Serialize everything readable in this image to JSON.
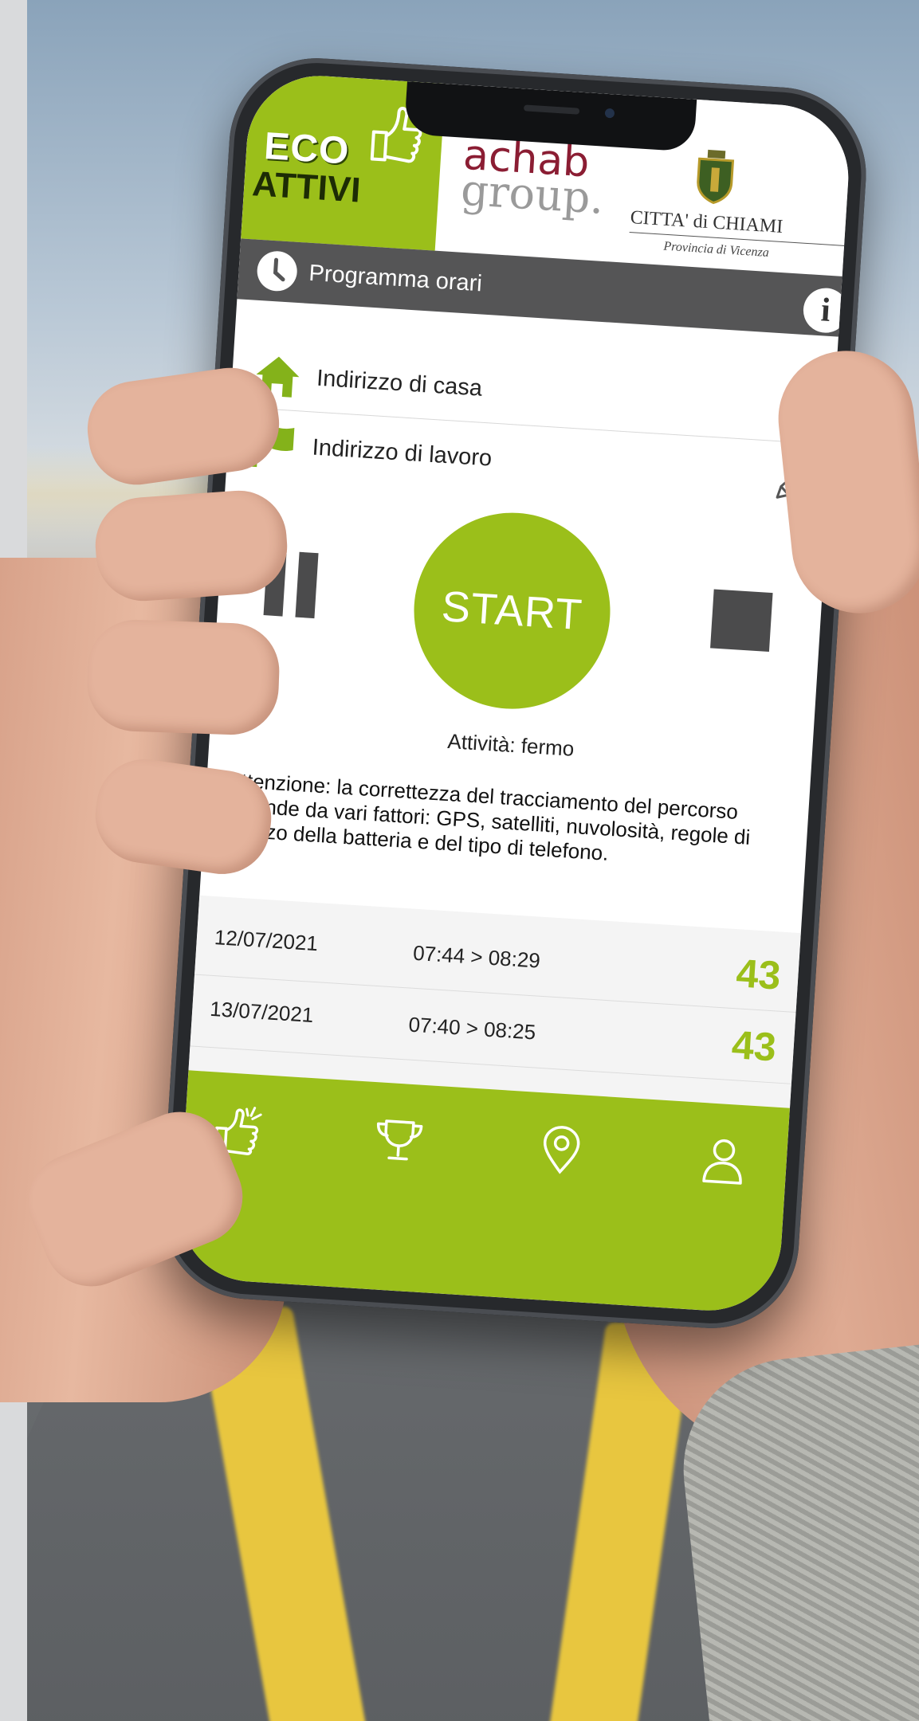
{
  "brand": {
    "app_logo_line1": "ECO",
    "app_logo_line2": "ATTIVI",
    "partner_line1": "achab",
    "partner_line2": "group.",
    "city": "CITTA' di CHIAMI",
    "province": "Provincia di Vicenza",
    "accent_color": "#9bbf1a"
  },
  "topbar": {
    "title": "Programma orari",
    "info_label": "i"
  },
  "addresses": [
    {
      "label": "Indirizzo di casa",
      "icon": "home-icon"
    },
    {
      "label": "Indirizzo di lavoro",
      "icon": "flag-icon"
    }
  ],
  "controls": {
    "start_label": "START",
    "activity_status": "Attività: fermo"
  },
  "warning_text": "Attenzione: la correttezza del tracciamento del percorso dipende da vari fattori: GPS, satelliti, nuvolosità, regole di utilizzo della batteria e del tipo di telefono.",
  "history": [
    {
      "date": "12/07/2021",
      "time": "07:44 > 08:29",
      "points": "43"
    },
    {
      "date": "13/07/2021",
      "time": "07:40 > 08:25",
      "points": "43"
    }
  ],
  "nav": [
    "like-icon",
    "trophy-icon",
    "location-pin-icon",
    "user-icon"
  ]
}
